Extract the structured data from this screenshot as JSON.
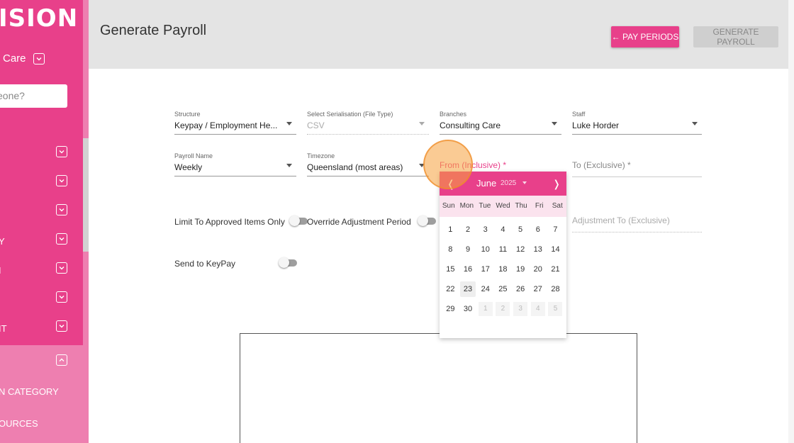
{
  "sidebar": {
    "logo_text": "ISION",
    "org_name": "Care",
    "search_placeholder": "eone?",
    "items": [
      {
        "label": ""
      },
      {
        "label": ""
      },
      {
        "label": ""
      },
      {
        "label": "Y"
      },
      {
        "label": "I"
      },
      {
        "label": ""
      },
      {
        "label": "IT"
      }
    ],
    "lower_items": [
      {
        "label": "N CATEGORY"
      },
      {
        "label": "OURCES"
      }
    ]
  },
  "header": {
    "title": "Generate Payroll",
    "pay_periods_label": "← PAY PERIODS",
    "generate_label": "GENERATE PAYROLL"
  },
  "form": {
    "structure": {
      "label": "Structure",
      "value": "Keypay / Employment He..."
    },
    "serialisation": {
      "label": "Select Serialisation (File Type)",
      "value": "CSV"
    },
    "branches": {
      "label": "Branches",
      "value": "Consulting Care"
    },
    "staff": {
      "label": "Staff",
      "value": "Luke Horder"
    },
    "payroll_name": {
      "label": "Payroll Name",
      "value": "Weekly"
    },
    "timezone": {
      "label": "Timezone",
      "value": "Queensland (most areas)"
    },
    "from": {
      "label": "From (Inclusive) *"
    },
    "to": {
      "label": "To (Exclusive) *"
    },
    "adjustment_to": {
      "label": "Adjustment To (Exclusive)"
    },
    "limit_approved": {
      "label": "Limit To Approved Items Only",
      "on": false
    },
    "override_adjustment": {
      "label": "Override Adjustment Period",
      "on": false
    },
    "send_keypay": {
      "label": "Send to KeyPay",
      "on": false
    }
  },
  "datepicker": {
    "prev": "❬",
    "next": "❭",
    "month": "June",
    "year": "2025",
    "weekdays": [
      "Sun",
      "Mon",
      "Tue",
      "Wed",
      "Thu",
      "Fri",
      "Sat"
    ],
    "weeks": [
      [
        "1",
        "2",
        "3",
        "4",
        "5",
        "6",
        "7"
      ],
      [
        "8",
        "9",
        "10",
        "11",
        "12",
        "13",
        "14"
      ],
      [
        "15",
        "16",
        "17",
        "18",
        "19",
        "20",
        "21"
      ],
      [
        "22",
        "23",
        "24",
        "25",
        "26",
        "27",
        "28"
      ],
      [
        "29",
        "30",
        "1",
        "2",
        "3",
        "4",
        "5"
      ]
    ],
    "today": "23",
    "colors": {
      "accent": "#e8408a",
      "dow_bg": "#fbe3ee"
    }
  }
}
